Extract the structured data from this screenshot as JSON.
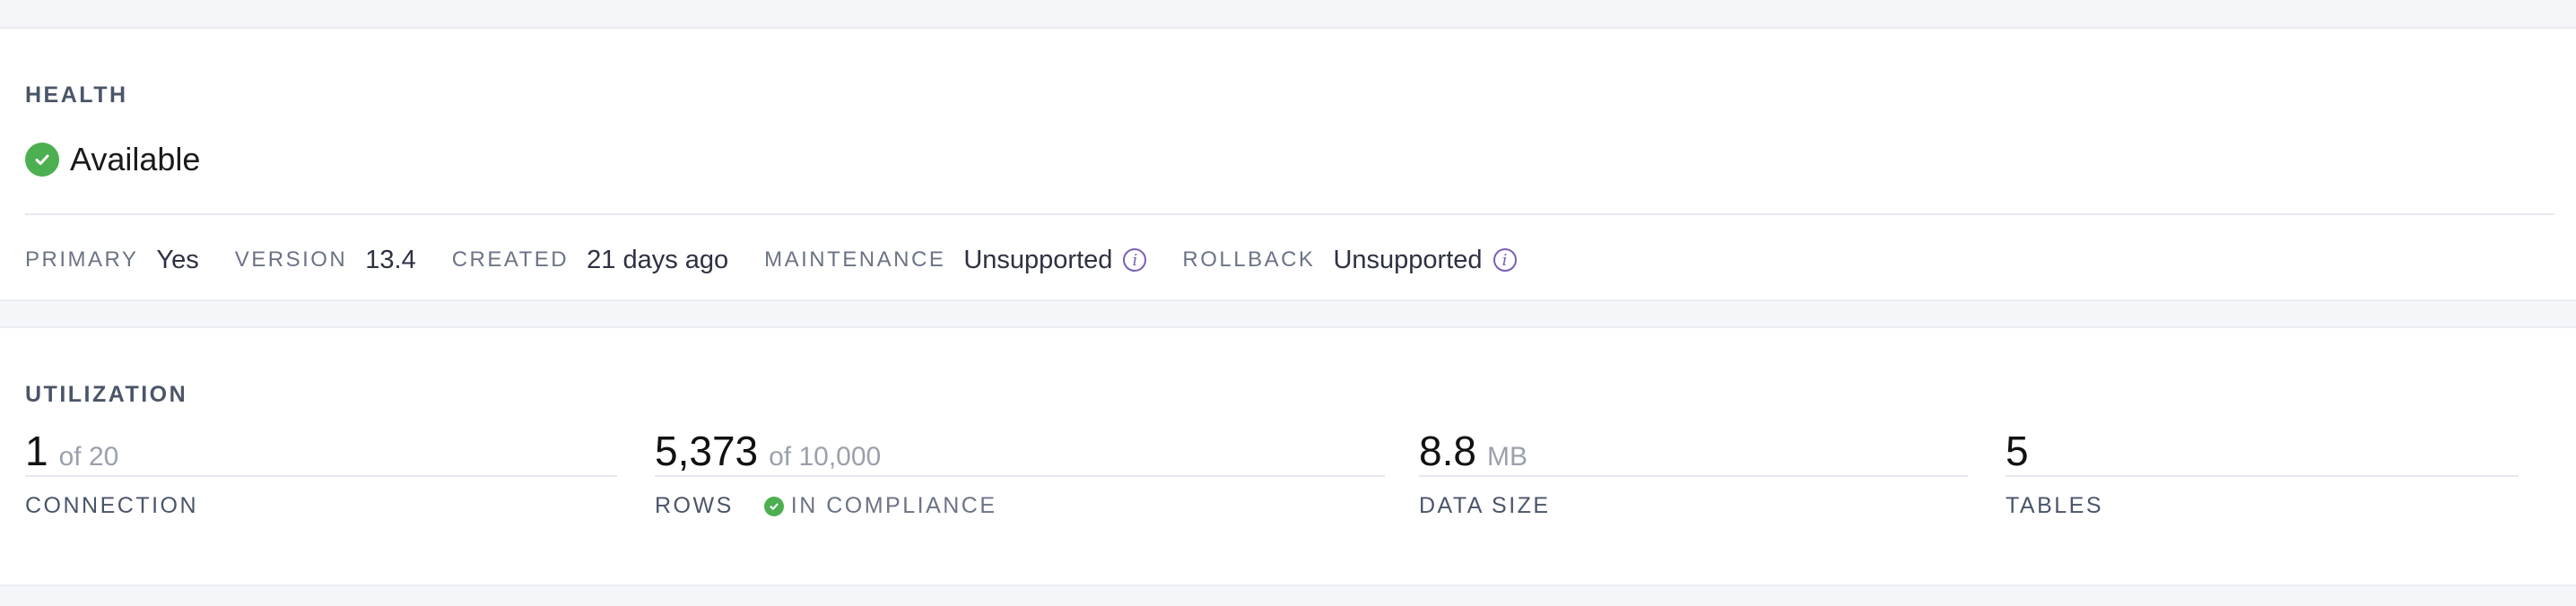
{
  "health": {
    "title": "HEALTH",
    "status": "Available",
    "status_color": "#4caf50",
    "meta": {
      "primary_label": "PRIMARY",
      "primary_value": "Yes",
      "version_label": "VERSION",
      "version_value": "13.4",
      "created_label": "CREATED",
      "created_value": "21 days ago",
      "maintenance_label": "MAINTENANCE",
      "maintenance_value": "Unsupported",
      "rollback_label": "ROLLBACK",
      "rollback_value": "Unsupported",
      "info_glyph": "i"
    }
  },
  "utilization": {
    "title": "UTILIZATION",
    "connection": {
      "value": "1",
      "sub": "of 20",
      "label": "CONNECTION"
    },
    "rows": {
      "value": "5,373",
      "sub": "of 10,000",
      "label": "ROWS",
      "compliance": "IN COMPLIANCE"
    },
    "data_size": {
      "value": "8.8",
      "sub": "MB",
      "label": "DATA SIZE"
    },
    "tables": {
      "value": "5",
      "label": "TABLES"
    }
  },
  "icons": {
    "status_icon": "check-circle-icon",
    "info_icon": "info-icon",
    "accent_color": "#7a5fb5"
  }
}
